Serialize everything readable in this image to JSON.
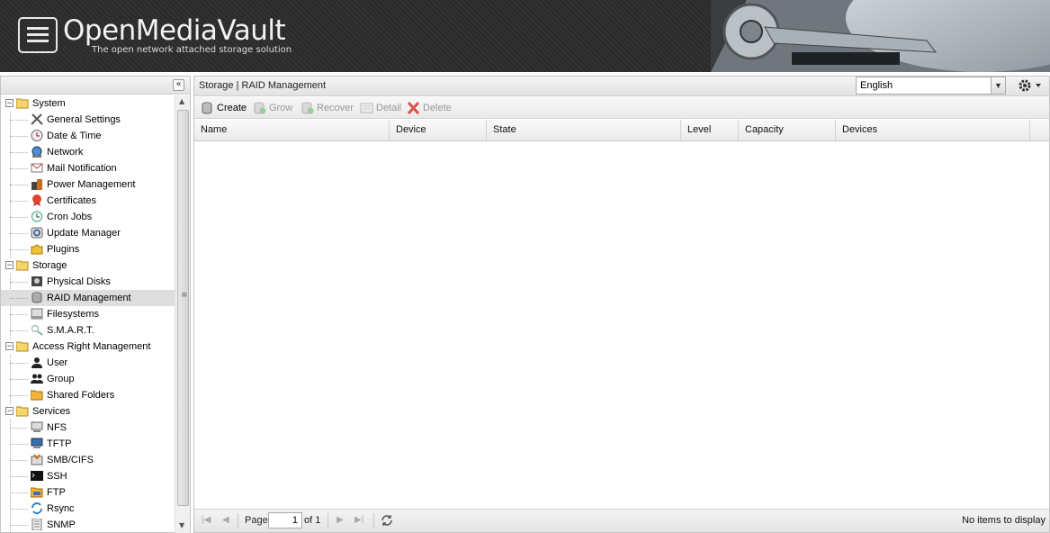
{
  "header": {
    "title": "OpenMediaVault",
    "subtitle": "The open network attached storage solution"
  },
  "nav": {
    "collapse_icon": "double-chevron-left-icon",
    "groups": [
      {
        "label": "System",
        "items": [
          {
            "label": "General Settings",
            "icon": "wrench-screwdriver-icon"
          },
          {
            "label": "Date & Time",
            "icon": "clock-icon"
          },
          {
            "label": "Network",
            "icon": "globe-icon"
          },
          {
            "label": "Mail Notification",
            "icon": "mail-icon"
          },
          {
            "label": "Power Management",
            "icon": "power-plug-icon"
          },
          {
            "label": "Certificates",
            "icon": "certificate-icon"
          },
          {
            "label": "Cron Jobs",
            "icon": "cron-clock-icon"
          },
          {
            "label": "Update Manager",
            "icon": "update-icon"
          },
          {
            "label": "Plugins",
            "icon": "puzzle-icon"
          }
        ]
      },
      {
        "label": "Storage",
        "items": [
          {
            "label": "Physical Disks",
            "icon": "hard-disk-icon"
          },
          {
            "label": "RAID Management",
            "icon": "raid-icon",
            "selected": true
          },
          {
            "label": "Filesystems",
            "icon": "filesystem-icon"
          },
          {
            "label": "S.M.A.R.T.",
            "icon": "smart-icon"
          }
        ]
      },
      {
        "label": "Access Right Management",
        "items": [
          {
            "label": "User",
            "icon": "user-icon"
          },
          {
            "label": "Group",
            "icon": "group-icon"
          },
          {
            "label": "Shared Folders",
            "icon": "shared-folder-icon"
          }
        ]
      },
      {
        "label": "Services",
        "items": [
          {
            "label": "NFS",
            "icon": "nfs-icon"
          },
          {
            "label": "TFTP",
            "icon": "tftp-icon"
          },
          {
            "label": "SMB/CIFS",
            "icon": "smb-icon"
          },
          {
            "label": "SSH",
            "icon": "terminal-icon"
          },
          {
            "label": "FTP",
            "icon": "ftp-icon"
          },
          {
            "label": "Rsync",
            "icon": "rsync-icon"
          },
          {
            "label": "SNMP",
            "icon": "snmp-icon"
          }
        ]
      }
    ]
  },
  "main": {
    "breadcrumb": "Storage | RAID Management",
    "language": {
      "selected": "English"
    },
    "toolbar": {
      "create": "Create",
      "grow": "Grow",
      "recover": "Recover",
      "detail": "Detail",
      "delete": "Delete"
    },
    "columns": [
      "Name",
      "Device",
      "State",
      "Level",
      "Capacity",
      "Devices"
    ],
    "rows": [],
    "pager": {
      "page_label": "Page",
      "page_value": "1",
      "of_label": "of 1",
      "status": "No items to display"
    }
  },
  "colors": {
    "header_bg": "#2e2e2e",
    "selected_row": "#dedede",
    "delete_red": "#d9362b",
    "border": "#c5c5c5"
  }
}
